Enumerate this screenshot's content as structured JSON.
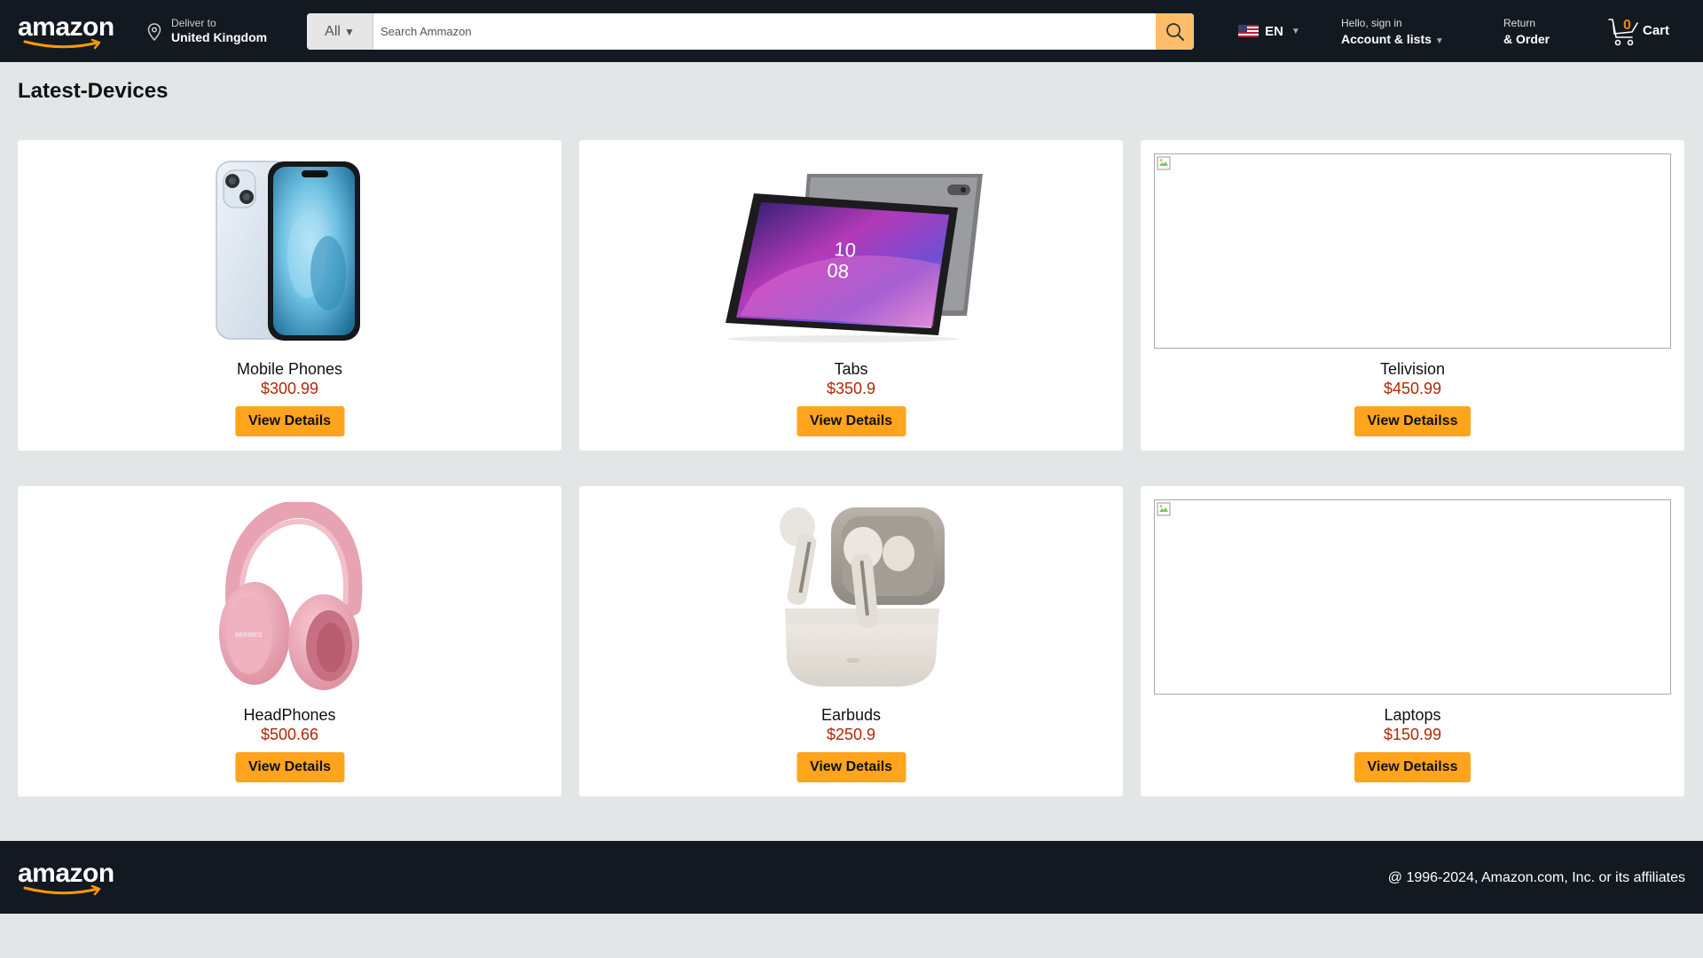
{
  "header": {
    "logo_text": "amazon",
    "deliver": {
      "line1": "Deliver to",
      "line2": "United Kingdom"
    },
    "search": {
      "category": "All",
      "placeholder": "Search Ammazon"
    },
    "language": {
      "code": "EN"
    },
    "account": {
      "line1": "Hello, sign in",
      "line2": "Account & lists"
    },
    "returns": {
      "line1": "Return",
      "line2": "& Order"
    },
    "cart": {
      "count": "0",
      "label": "Cart"
    }
  },
  "main": {
    "title": "Latest-Devices",
    "products": [
      {
        "name": "Mobile Phones",
        "price": "$300.99",
        "button": "View Details",
        "image": "phone-image"
      },
      {
        "name": "Tabs",
        "price": "$350.9",
        "button": "View Details",
        "image": "tablet-image"
      },
      {
        "name": "Telivision",
        "price": "$450.99",
        "button": "View Detailss",
        "image": "broken-image"
      },
      {
        "name": "HeadPhones",
        "price": "$500.66",
        "button": "View Details",
        "image": "headphones-image"
      },
      {
        "name": "Earbuds",
        "price": "$250.9",
        "button": "View Details",
        "image": "earbuds-image"
      },
      {
        "name": "Laptops",
        "price": "$150.99",
        "button": "View Detailss",
        "image": "broken-image"
      }
    ]
  },
  "footer": {
    "logo_text": "amazon",
    "copyright": "@ 1996-2024, Amazon.com, Inc. or its affiliates"
  },
  "colors": {
    "nav_bg": "#131921",
    "search_button": "#febd69",
    "cta_button": "#ffa41c",
    "price": "#b12704",
    "cart_count": "#f08804",
    "page_bg": "#e3e6e6"
  }
}
